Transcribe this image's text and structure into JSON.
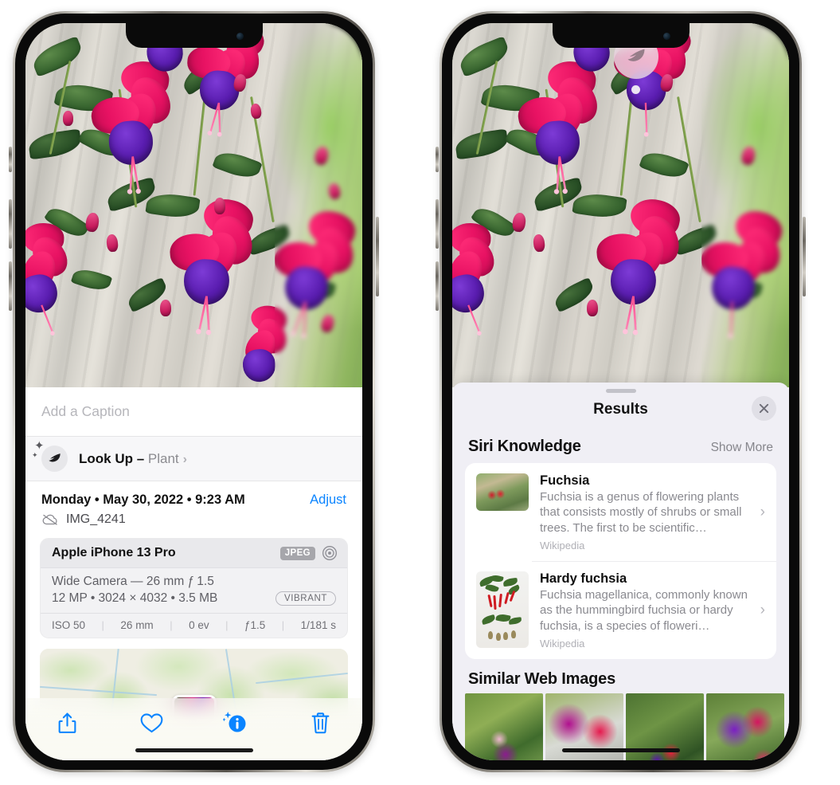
{
  "left_phone": {
    "photo": {
      "alt": "fuchsia-flowers-photo"
    },
    "caption": {
      "placeholder": "Add a Caption",
      "value": ""
    },
    "lookup": {
      "icon": "leaf-icon",
      "label": "Look Up – ",
      "subject": "Plant",
      "chevron": "›"
    },
    "info": {
      "date": "Monday • May 30, 2022 • 9:23 AM",
      "adjust_label": "Adjust",
      "cloud_icon": "icloud-slash-icon",
      "filename": "IMG_4241",
      "device": "Apple iPhone 13 Pro",
      "format_tag": "JPEG",
      "aperture_icon": "aperture-icon",
      "lens_line": "Wide Camera — 26 mm ƒ 1.5",
      "size_line": "12 MP • 3024 × 4032 • 3.5 MB",
      "vibrant_tag": "VIBRANT",
      "exif": [
        "ISO 50",
        "26 mm",
        "0 ev",
        "ƒ1.5",
        "1/181 s"
      ]
    },
    "toolbar": [
      {
        "name": "share-button",
        "icon": "share-icon"
      },
      {
        "name": "favorite-button",
        "icon": "heart-icon"
      },
      {
        "name": "info-button",
        "icon": "info-sparkle-icon"
      },
      {
        "name": "delete-button",
        "icon": "trash-icon"
      }
    ]
  },
  "right_phone": {
    "photo_badge": {
      "icon": "leaf-icon",
      "name": "visual-lookup-leaf-badge"
    },
    "sheet": {
      "title": "Results",
      "close_label": "✕"
    },
    "siri_knowledge": {
      "section_title": "Siri Knowledge",
      "show_more": "Show More",
      "items": [
        {
          "title": "Fuchsia",
          "desc": "Fuchsia is a genus of flowering plants that consists mostly of shrubs or small trees. The first to be scientific…",
          "source": "Wikipedia",
          "thumb": "fuchsia-red-flowers-thumb",
          "chevron": "›"
        },
        {
          "title": "Hardy fuchsia",
          "desc": "Fuchsia magellanica, commonly known as the hummingbird fuchsia or hardy fuchsia, is a species of floweri…",
          "source": "Wikipedia",
          "thumb": "hardy-fuchsia-specimen-thumb",
          "chevron": "›"
        }
      ]
    },
    "similar_web_images": {
      "section_title": "Similar Web Images",
      "items": [
        "magenta-fuchsia-leaves-image",
        "red-pink-fuchsia-closeup-image",
        "fuchsia-bush-buds-image",
        "purple-pink-fuchsia-cluster-image"
      ]
    }
  }
}
